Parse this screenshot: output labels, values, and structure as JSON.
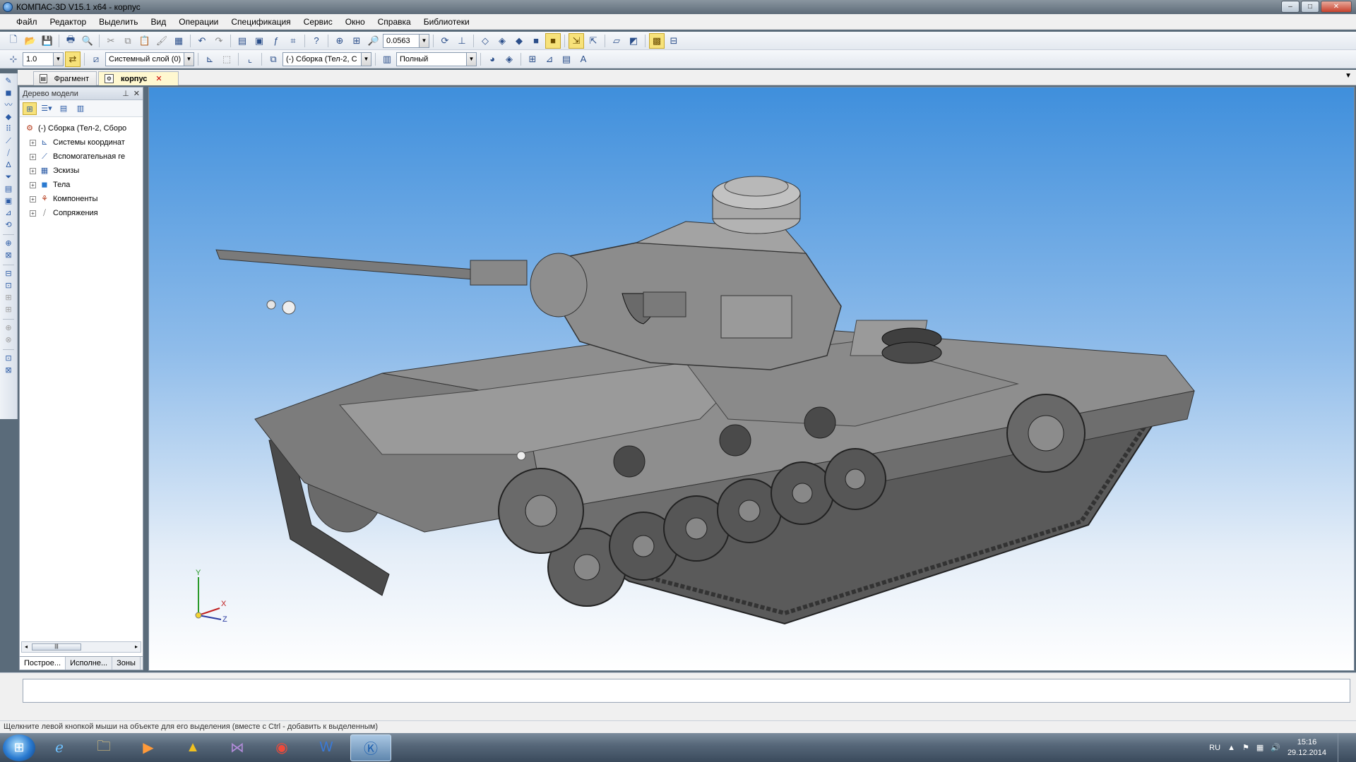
{
  "window": {
    "title": "КОМПАС-3D V15.1 x64 - корпус",
    "min": "–",
    "max": "□",
    "close": "✕"
  },
  "menu": [
    "Файл",
    "Редактор",
    "Выделить",
    "Вид",
    "Операции",
    "Спецификация",
    "Сервис",
    "Окно",
    "Справка",
    "Библиотеки"
  ],
  "toolbar1": {
    "zoom_value": "0.0563"
  },
  "toolbar2": {
    "scale_value": "1.0",
    "layer_value": "Системный слой (0)",
    "component_value": "(-) Сборка (Тел-2, С",
    "display_mode": "Полный"
  },
  "doc_tabs": [
    {
      "label": "Фрагмент",
      "active": false
    },
    {
      "label": "корпус",
      "active": true
    }
  ],
  "tree_panel": {
    "title": "Дерево модели",
    "root": "(-) Сборка (Тел-2, Сборо",
    "items": [
      {
        "label": "Системы координат",
        "icon": "coord-icon"
      },
      {
        "label": "Вспомогательная ге",
        "icon": "aux-geometry-icon"
      },
      {
        "label": "Эскизы",
        "icon": "sketch-icon"
      },
      {
        "label": "Тела",
        "icon": "body-icon"
      },
      {
        "label": "Компоненты",
        "icon": "components-icon"
      },
      {
        "label": "Сопряжения",
        "icon": "mates-icon"
      }
    ],
    "tabs": [
      "Построе...",
      "Исполне...",
      "Зоны"
    ]
  },
  "axes": {
    "x": "X",
    "y": "Y",
    "z": "Z"
  },
  "status_text": "Щелкните левой кнопкой мыши на объекте для его выделения (вместе с Ctrl - добавить к выделенным)",
  "taskbar": {
    "lang": "RU",
    "time": "15:16",
    "date": "29.12.2014"
  }
}
